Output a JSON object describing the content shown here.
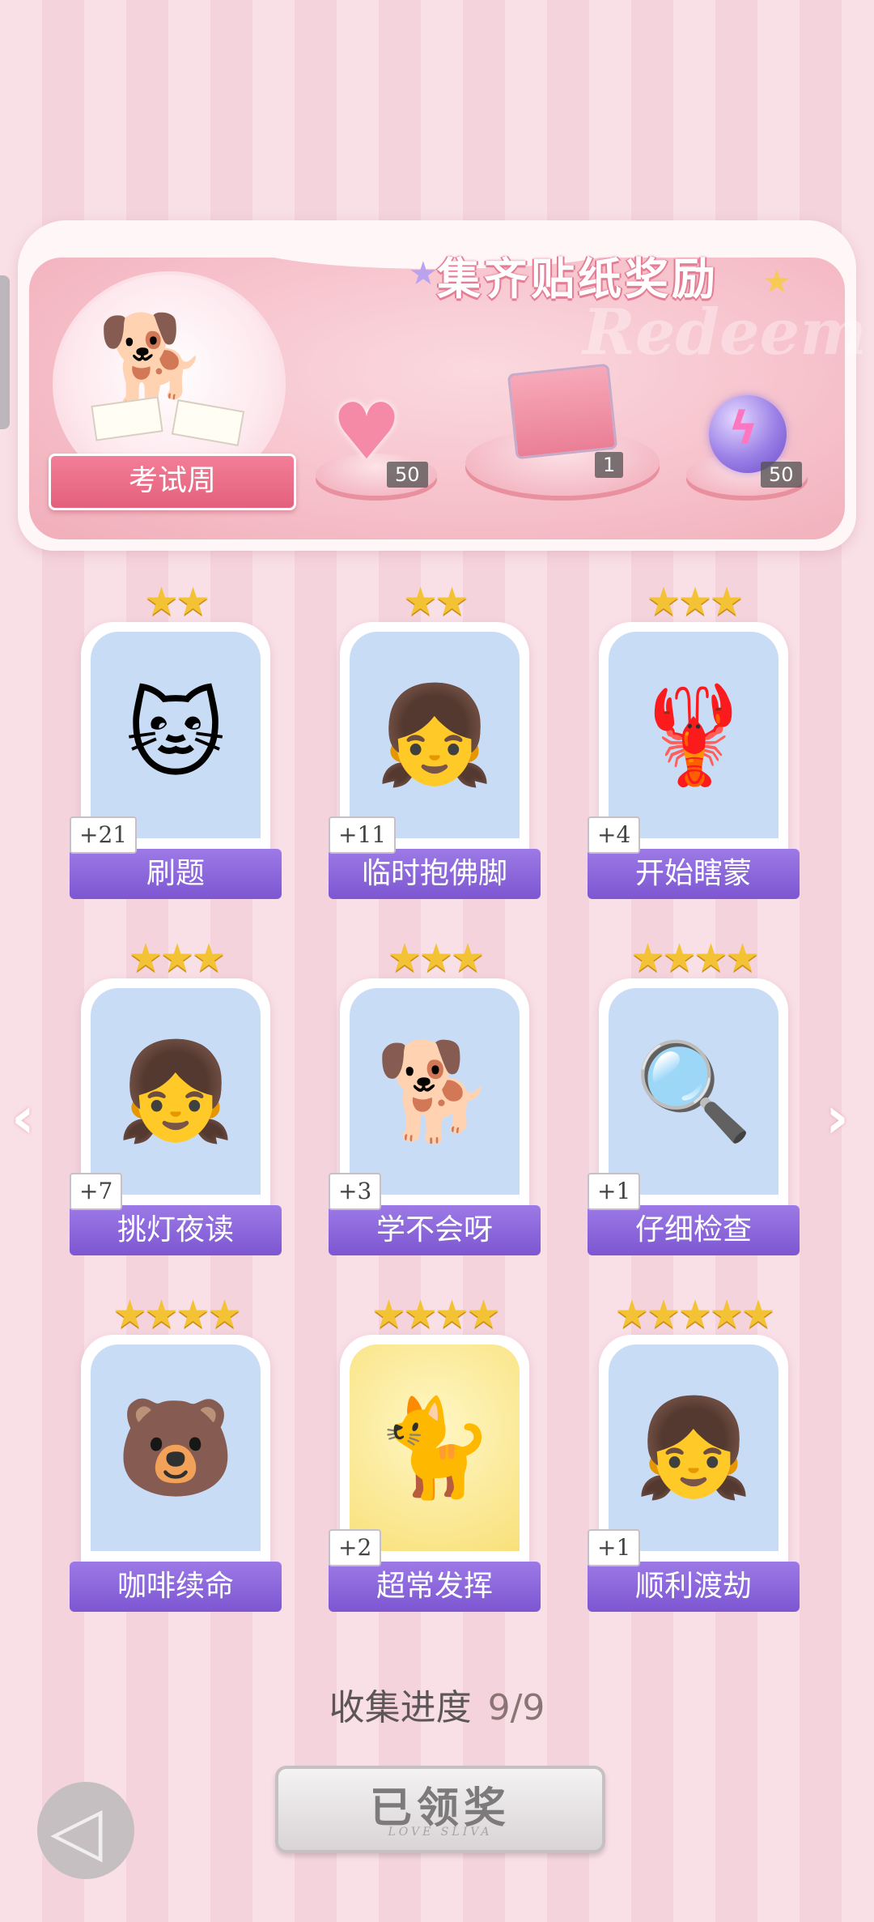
{
  "banner": {
    "title": "集齐贴纸奖励",
    "watermark": "Redeem",
    "theme_label": "考试周",
    "rewards": [
      {
        "icon": "heart-gem-icon",
        "count": "50"
      },
      {
        "icon": "gift-box-icon",
        "count": "1"
      },
      {
        "icon": "lightning-orb-icon",
        "count": "50"
      }
    ]
  },
  "stickers": [
    {
      "name": "刷题",
      "count": "+21",
      "stars": "★★",
      "icon": "🐱"
    },
    {
      "name": "临时抱佛脚",
      "count": "+11",
      "stars": "★★",
      "icon": "👧"
    },
    {
      "name": "开始瞎蒙",
      "count": "+4",
      "stars": "★★★",
      "icon": "🦞"
    },
    {
      "name": "挑灯夜读",
      "count": "+7",
      "stars": "★★★",
      "icon": "👧"
    },
    {
      "name": "学不会呀",
      "count": "+3",
      "stars": "★★★",
      "icon": "🐕"
    },
    {
      "name": "仔细检查",
      "count": "+1",
      "stars": "★★★★",
      "icon": "🔍"
    },
    {
      "name": "咖啡续命",
      "count": "",
      "stars": "★★★★",
      "icon": "🐻"
    },
    {
      "name": "超常发挥",
      "count": "+2",
      "stars": "★★★★",
      "icon": "🐈"
    },
    {
      "name": "顺利渡劫",
      "count": "+1",
      "stars": "★★★★★",
      "icon": "👧"
    }
  ],
  "progress": {
    "label": "收集进度",
    "value": "9/9"
  },
  "claim_button": {
    "label": "已领奖",
    "sub": "LOVE SLIVA"
  },
  "colors": {
    "accent_purple": "#7d56d1",
    "banner_pink": "#f6bfc9",
    "star_gold": "#f4c235"
  }
}
